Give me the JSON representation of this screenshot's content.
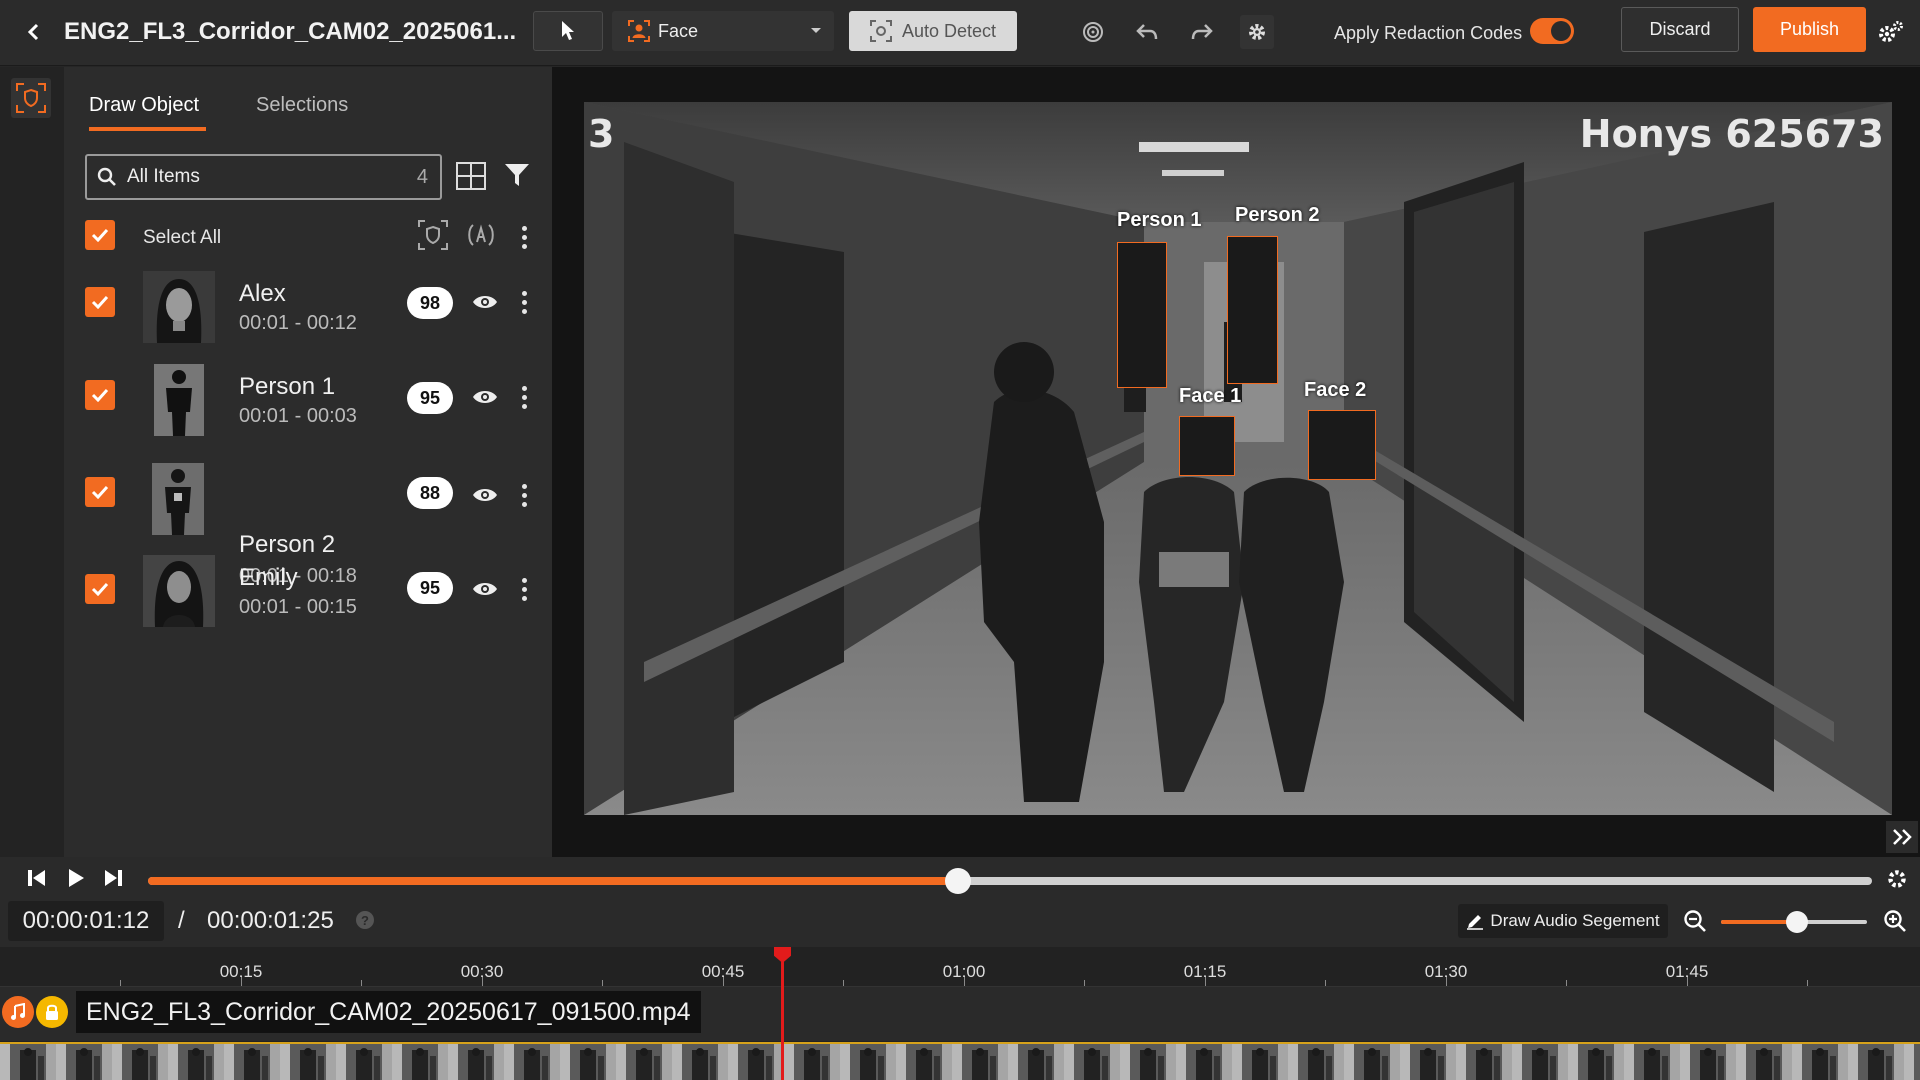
{
  "header": {
    "title": "ENG2_FL3_Corridor_CAM02_2025061...",
    "back_icon": "chevron-left-icon",
    "detect_mode": "Face",
    "auto_detect_label": "Auto Detect",
    "apply_redaction_label": "Apply Redaction Codes",
    "apply_redaction_on": true,
    "discard_label": "Discard",
    "publish_label": "Publish"
  },
  "colors": {
    "accent": "#f26b21",
    "panel": "#2c2c2c",
    "background": "#262626",
    "playhead": "#e21b1b"
  },
  "panel": {
    "tabs": [
      {
        "label": "Draw Object",
        "active": true
      },
      {
        "label": "Selections",
        "active": false
      }
    ],
    "search": {
      "placeholder": "All Items",
      "count": "4"
    },
    "select_all_label": "Select All",
    "items": [
      {
        "name": "Alex",
        "time": "00:01 - 00:12",
        "score": "98",
        "checked": true
      },
      {
        "name": "Person 1",
        "time": "00:01 - 00:03",
        "score": "95",
        "checked": true
      },
      {
        "name": "Person 2",
        "time": "00:01 - 00:18",
        "score": "88",
        "checked": true
      },
      {
        "name": "Emily",
        "time": "00:01 - 00:15",
        "score": "95",
        "checked": true
      }
    ]
  },
  "video": {
    "osd_left": "3",
    "osd_right": "Honys 625673",
    "boxes": [
      {
        "label": "Person 1"
      },
      {
        "label": "Person 2"
      },
      {
        "label": "Face 1"
      },
      {
        "label": "Face 2"
      }
    ]
  },
  "player": {
    "current_time": "00:00:01:12",
    "separator": "/",
    "total_time": "00:00:01:25",
    "progress_fraction": 0.47,
    "draw_audio_label": "Draw Audio Segement",
    "zoom_fraction": 0.52
  },
  "timeline": {
    "ticks": [
      "00:15",
      "00:30",
      "00:45",
      "01:00",
      "01:15",
      "01:30",
      "01:45"
    ],
    "clip_name": "ENG2_FL3_Corridor_CAM02_20250617_091500.mp4"
  }
}
